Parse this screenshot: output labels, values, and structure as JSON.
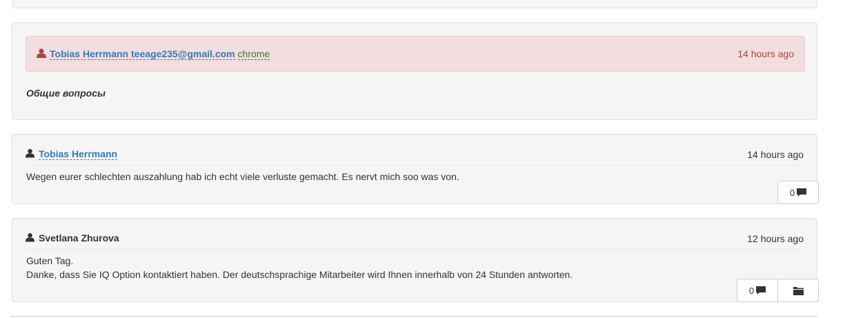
{
  "prev_box": {
    "link_fragment": "...gmail@..."
  },
  "ticket": {
    "author_name": "Tobias Herrmann",
    "author_email": "teeage235@gmail.com",
    "browser": "chrome",
    "time": "14 hours ago",
    "subject": "Общие вопросы",
    "icon": "user-icon"
  },
  "comments": [
    {
      "author": "Tobias Herrmann",
      "author_is_link": true,
      "time": "14 hours ago",
      "lines": [
        "Wegen eurer schlechten auszahlung hab ich echt viele verluste gemacht. Es nervt mich soo was von."
      ],
      "reply_count": "0",
      "buttons": [
        "comment-icon"
      ]
    },
    {
      "author": "Svetlana Zhurova",
      "author_is_link": false,
      "time": "12 hours ago",
      "lines": [
        "Guten Tag.",
        "Danke, dass Sie IQ Option kontaktiert haben. Der deutschsprachige Mitarbeiter wird Ihnen innerhalb von 24 Stunden antworten."
      ],
      "reply_count": "0",
      "buttons": [
        "comment-icon",
        "folder-icon"
      ]
    }
  ],
  "colors": {
    "alert_bg": "#f2dede",
    "alert_text": "#a94442",
    "link": "#337ab7",
    "browser_tag": "#3c763d",
    "panel_bg": "#f5f5f5"
  }
}
